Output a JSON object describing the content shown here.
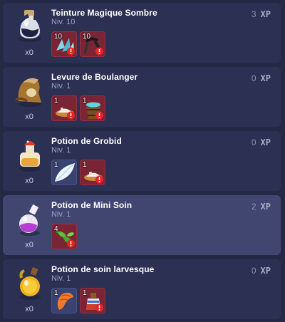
{
  "xp_label": "XP",
  "colors": {
    "background": "#242946",
    "row": "#2c3154",
    "row_selected": "#404670",
    "missing": "#7a2535",
    "ok": "#3a4270"
  },
  "recipes": [
    {
      "name": "Teinture Magique Sombre",
      "level": "Niv. 10",
      "quantity": "x0",
      "xp": "3",
      "icon": "dark-dye-bottle-icon",
      "selected": false,
      "ingredients": [
        {
          "count": "10",
          "icon": "blue-crystal-icon",
          "missing": true
        },
        {
          "count": "10",
          "icon": "dark-tool-icon",
          "missing": true
        }
      ]
    },
    {
      "name": "Levure de Boulanger",
      "level": "Niv. 1",
      "quantity": "x0",
      "xp": "0",
      "icon": "yeast-bag-icon",
      "selected": false,
      "ingredients": [
        {
          "count": "1",
          "icon": "flour-pile-icon",
          "missing": true
        },
        {
          "count": "1",
          "icon": "water-bucket-icon",
          "missing": true
        }
      ]
    },
    {
      "name": "Potion de Grobid",
      "level": "Niv. 1",
      "quantity": "x0",
      "xp": "0",
      "icon": "grobid-potion-icon",
      "selected": false,
      "ingredients": [
        {
          "count": "1",
          "icon": "white-feather-icon",
          "missing": false
        },
        {
          "count": "1",
          "icon": "flour-pile-icon",
          "missing": true
        }
      ]
    },
    {
      "name": "Potion de Mini Soin",
      "level": "Niv. 1",
      "quantity": "x0",
      "xp": "2",
      "icon": "purple-potion-icon",
      "selected": true,
      "ingredients": [
        {
          "count": "4",
          "icon": "green-herb-icon",
          "missing": true
        }
      ]
    },
    {
      "name": "Potion de soin larvesque",
      "level": "Niv. 1",
      "quantity": "x0",
      "xp": "0",
      "icon": "orange-potion-icon",
      "selected": false,
      "ingredients": [
        {
          "count": "1",
          "icon": "orange-larva-icon",
          "missing": false
        },
        {
          "count": "1",
          "icon": "red-potion-icon",
          "missing": true
        }
      ]
    }
  ]
}
